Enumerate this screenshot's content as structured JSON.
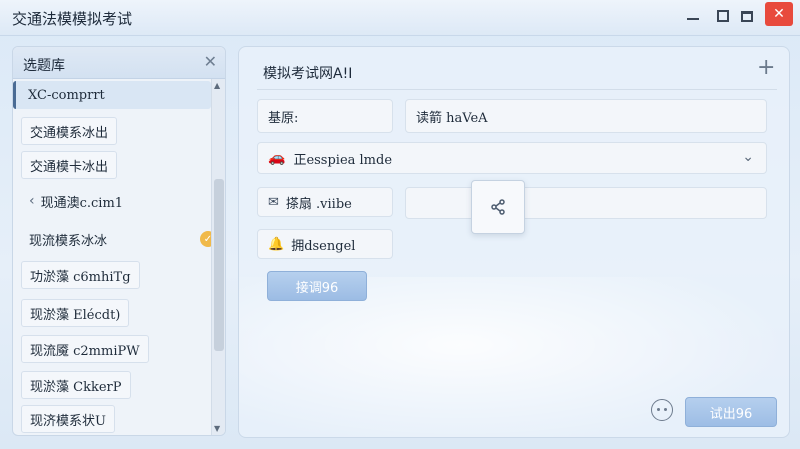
{
  "window": {
    "title": "交通法模模拟考试",
    "controls": {
      "close_glyph": "✕"
    }
  },
  "sidebar": {
    "title": "选题库",
    "close_glyph": "✕",
    "items": [
      {
        "label": "XC-comprrt",
        "state": "active"
      },
      {
        "label": "交通模系冰出",
        "state": "boxed"
      },
      {
        "label": "交通模卡冰出",
        "state": "boxed"
      },
      {
        "label": "现通澳c.cim1",
        "state": "group"
      },
      {
        "label": "现流模系冰冰",
        "state": "checked"
      },
      {
        "label": "功淤藻 c6mhiTg",
        "state": "boxed"
      },
      {
        "label": "现淤藻 Elécdt)",
        "state": "boxed"
      },
      {
        "label": "现流魇 c2mmiPW",
        "state": "boxed"
      },
      {
        "label": "现淤藻 CkkerP",
        "state": "boxed"
      },
      {
        "label": "现济模系状U",
        "state": "boxed"
      }
    ],
    "group_chevron": "‹",
    "check_glyph": "✓",
    "scroll_up": "▲",
    "scroll_down": "▼"
  },
  "main": {
    "title": "模拟考试网A!I",
    "plus_glyph": "+",
    "label_field": "基原:",
    "value_field": "读箭 haVeA",
    "select": {
      "icon": "🚗",
      "value": "正esspiea lmde",
      "chevron": "⌄"
    },
    "mail_field": {
      "icon": "✉",
      "label": "搽扇 .viibe"
    },
    "bell_field": {
      "icon": "🔔",
      "label": "拥dsengel"
    },
    "primary_button": "接调96",
    "exit_button": "试出96"
  },
  "colors": {
    "accent": "#9cbce4",
    "close": "#e84a3d",
    "check": "#f0b94a"
  }
}
